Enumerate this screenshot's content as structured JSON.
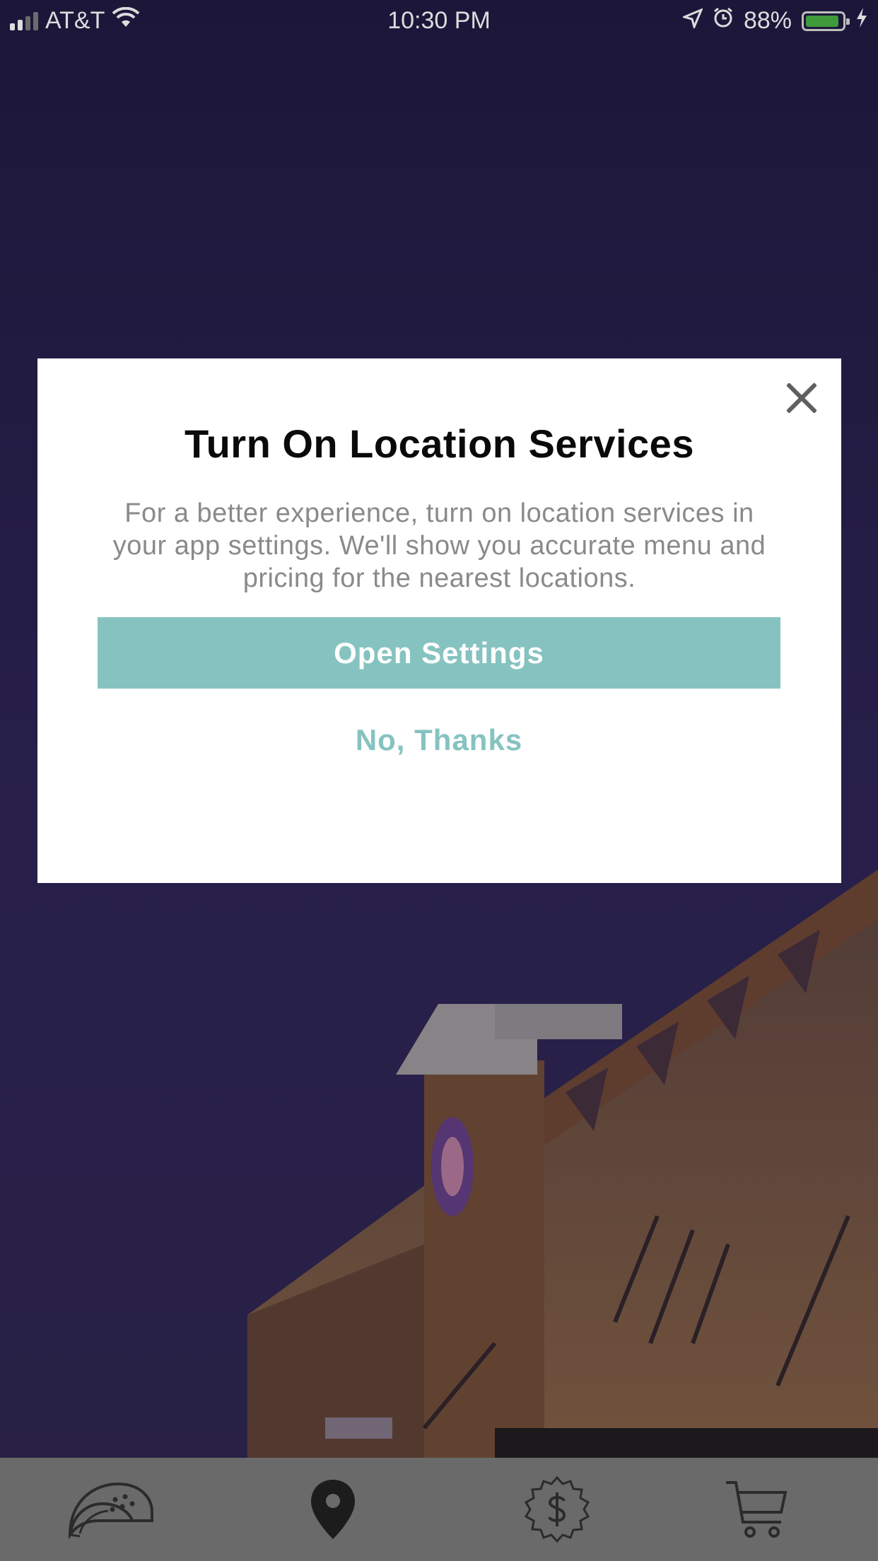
{
  "status_bar": {
    "carrier": "AT&T",
    "time": "10:30 PM",
    "battery_percent": "88%",
    "signal_bars": 2,
    "icons": [
      "wifi-icon",
      "location-arrow-icon",
      "alarm-icon",
      "battery-icon",
      "charging-bolt-icon"
    ]
  },
  "dialog": {
    "title": "Turn On Location Services",
    "message": "For a better experience, turn on location services in your app settings. We'll show you accurate menu and pricing for the nearest locations.",
    "primary_button": "Open Settings",
    "secondary_button": "No, Thanks",
    "close_icon": "close-icon"
  },
  "tab_bar": {
    "tabs": [
      {
        "icon": "taco-icon"
      },
      {
        "icon": "map-pin-icon"
      },
      {
        "icon": "dollar-badge-icon"
      },
      {
        "icon": "cart-icon"
      }
    ]
  },
  "colors": {
    "accent": "#86c3c0",
    "title": "#0a0a0a",
    "body_text": "#8a8a8a",
    "tab_bar": "#6a6a6a",
    "backdrop": "#221b3f"
  }
}
